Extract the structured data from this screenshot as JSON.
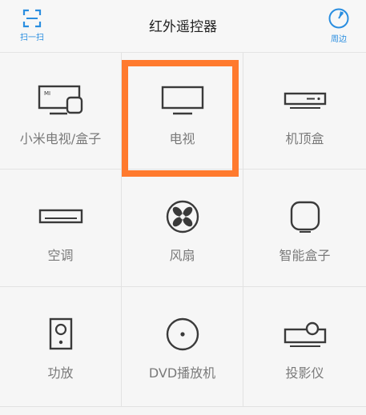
{
  "header": {
    "title": "红外遥控器",
    "scan_label": "扫一扫",
    "nearby_label": "周边"
  },
  "devices": [
    {
      "label": "小米电视/盒子",
      "icon": "mi-tv-box-icon"
    },
    {
      "label": "电视",
      "icon": "tv-icon"
    },
    {
      "label": "机顶盒",
      "icon": "set-top-box-icon"
    },
    {
      "label": "空调",
      "icon": "air-conditioner-icon"
    },
    {
      "label": "风扇",
      "icon": "fan-icon"
    },
    {
      "label": "智能盒子",
      "icon": "smart-box-icon"
    },
    {
      "label": "功放",
      "icon": "amplifier-icon"
    },
    {
      "label": "DVD播放机",
      "icon": "dvd-player-icon"
    },
    {
      "label": "投影仪",
      "icon": "projector-icon"
    }
  ],
  "colors": {
    "accent": "#2a8ee0",
    "highlight": "#ff7a2e",
    "icon": "#3a3a3a",
    "label": "#7a7a7a"
  }
}
